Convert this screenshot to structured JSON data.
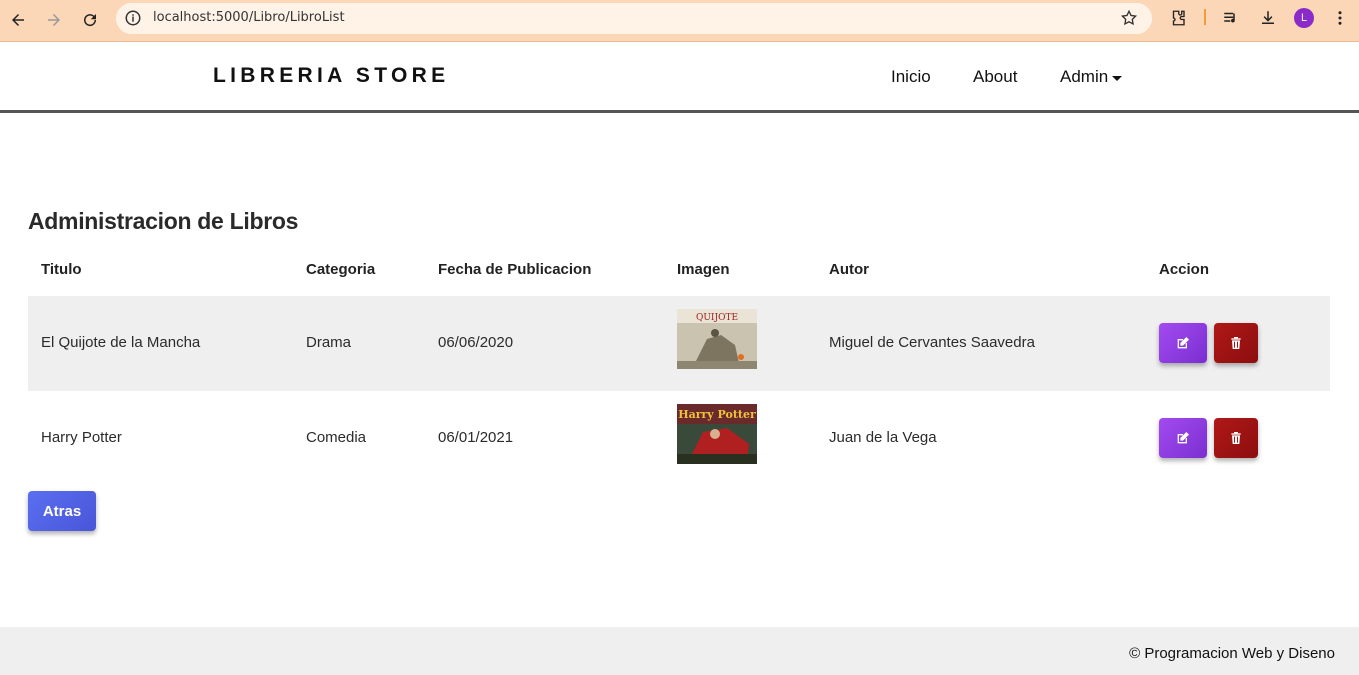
{
  "browser": {
    "url": "localhost:5000/Libro/LibroList",
    "profile_initial": "L"
  },
  "header": {
    "brand": "LIBRERIA STORE",
    "menu": {
      "inicio": "Inicio",
      "about": "About",
      "admin": "Admin"
    }
  },
  "main": {
    "title": "Administracion de Libros",
    "columns": [
      "Titulo",
      "Categoria",
      "Fecha de Publicacion",
      "Imagen",
      "Autor",
      "Accion"
    ],
    "rows": [
      {
        "titulo": "El Quijote de la Mancha",
        "categoria": "Drama",
        "fecha": "06/06/2020",
        "autor": "Miguel de Cervantes Saavedra",
        "image_icon": "quijote-cover-image"
      },
      {
        "titulo": "Harry Potter",
        "categoria": "Comedia",
        "fecha": "06/01/2021",
        "autor": "Juan de la Vega",
        "image_icon": "harry-potter-cover-image"
      }
    ],
    "back_label": "Atras"
  },
  "footer": {
    "text": "© Programacion Web y Diseno"
  },
  "colors": {
    "chrome": "#fbd7b8",
    "edit_button": "#8a38e0",
    "delete_button": "#a01414",
    "back_button": "#5263e6"
  }
}
